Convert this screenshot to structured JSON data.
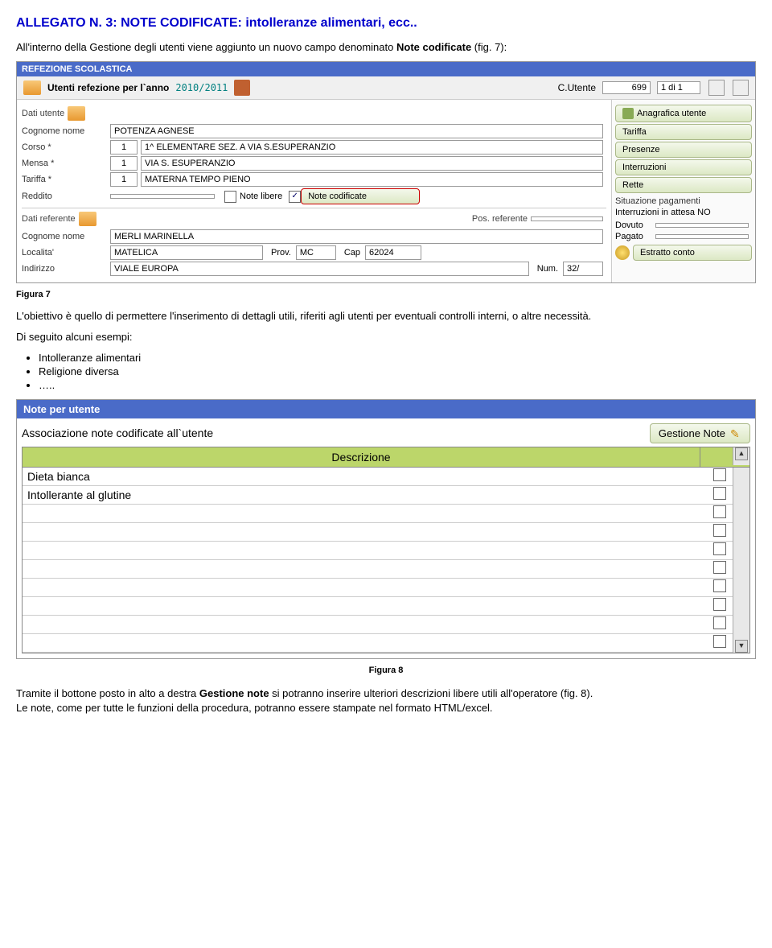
{
  "doc": {
    "title": "ALLEGATO N. 3: NOTE CODIFICATE: intolleranze alimentari, ecc..",
    "intro_prefix": "All'interno della Gestione degli utenti viene aggiunto un nuovo campo denominato ",
    "intro_bold": "Note codificate",
    "intro_suffix": " (fig. 7):"
  },
  "app": {
    "title": "REFEZIONE SCOLASTICA",
    "header_label": "Utenti refezione per l`anno",
    "year": "2010/2011",
    "c_utente_label": "C.Utente",
    "c_utente_value": "699",
    "rec_counter": "1 di 1",
    "dati_utente": "Dati utente",
    "cognome_nome_label": "Cognome nome",
    "cognome_nome_value": "POTENZA AGNESE",
    "corso_label": "Corso  *",
    "corso_code": "1",
    "corso_value": "1^ ELEMENTARE SEZ. A VIA S.ESUPERANZIO",
    "mensa_label": "Mensa  *",
    "mensa_code": "1",
    "mensa_value": "VIA S. ESUPERANZIO",
    "tariffa_label": "Tariffa  *",
    "tariffa_code": "1",
    "tariffa_value": "MATERNA TEMPO PIENO",
    "reddito_label": "Reddito",
    "note_libere_label": "Note libere",
    "note_codificate_label": "Note codificate",
    "dati_referente": "Dati referente",
    "pos_referente_label": "Pos. referente",
    "ref_cognome_label": "Cognome nome",
    "ref_cognome_value": "MERLI MARINELLA",
    "localita_label": "Localita'",
    "localita_value": "MATELICA",
    "prov_label": "Prov.",
    "prov_value": "MC",
    "cap_label": "Cap",
    "cap_value": "62024",
    "indirizzo_label": "Indirizzo",
    "indirizzo_value": "VIALE EUROPA",
    "num_label": "Num.",
    "num_value": "32/",
    "right": {
      "anagrafica": "Anagrafica utente",
      "tariffa": "Tariffa",
      "presenze": "Presenze",
      "interruzioni": "Interruzioni",
      "rette": "Rette",
      "situazione": "Situazione pagamenti",
      "int_attesa_label": "Interruzioni in attesa",
      "int_attesa_value": "NO",
      "dovuto": "Dovuto",
      "pagato": "Pagato",
      "estratto": "Estratto conto"
    }
  },
  "fig7_caption": "Figura 7",
  "obj_para": "L'obiettivo è quello di permettere l'inserimento di dettagli utili,   riferiti agli utenti per eventuali controlli interni, o altre necessità.",
  "examples_intro": "Di seguito alcuni esempi:",
  "examples": {
    "b1": "Intolleranze alimentari",
    "b2": "Religione diversa",
    "b3": "….."
  },
  "note": {
    "title": "Note per utente",
    "assoc": "Associazione note codificate all`utente",
    "gestione": "Gestione Note",
    "col_desc": "Descrizione",
    "rows": {
      "r0": "Dieta bianca",
      "r1": "Intollerante al glutine",
      "r2": "",
      "r3": "",
      "r4": "",
      "r5": "",
      "r6": "",
      "r7": "",
      "r8": "",
      "r9": ""
    }
  },
  "fig8_caption": "Figura 8",
  "closing_prefix": "Tramite il bottone posto in alto a destra ",
  "closing_bold": "Gestione note",
  "closing_mid": " si potranno inserire ulteriori descrizioni libere utili all'operatore (fig. 8).",
  "closing_line2": "Le note, come per tutte le funzioni della procedura, potranno essere stampate nel formato HTML/excel."
}
